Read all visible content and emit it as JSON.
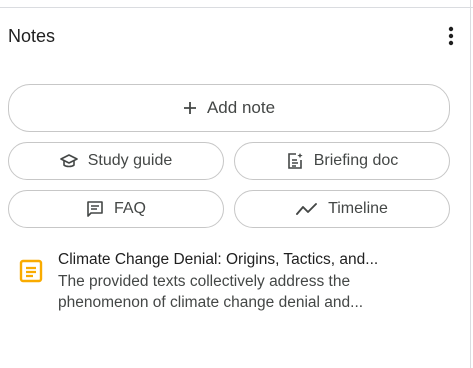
{
  "panel": {
    "title": "Notes"
  },
  "actions": {
    "add_note": "Add note",
    "study_guide": "Study guide",
    "briefing_doc": "Briefing doc",
    "faq": "FAQ",
    "timeline": "Timeline"
  },
  "notes": [
    {
      "title": "Climate Change Denial: Origins, Tactics, and...",
      "snippet_line1": "The provided texts collectively address the",
      "snippet_line2": "phenomenon of climate change denial and...",
      "icon": "note-document-icon",
      "icon_color": "#f9ab00"
    }
  ],
  "colors": {
    "border": "#c7c7c7",
    "text": "#1f1f1f",
    "muted": "#444746",
    "accent": "#f9ab00"
  }
}
